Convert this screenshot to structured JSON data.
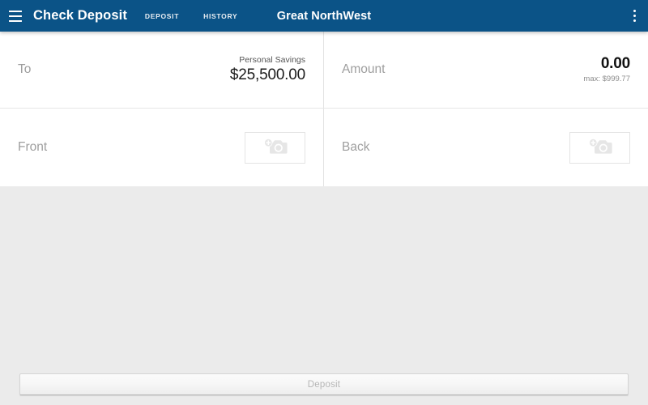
{
  "appbar": {
    "menu_icon": "hamburger-menu-icon",
    "title": "Check Deposit",
    "tabs": [
      {
        "label": "DEPOSIT"
      },
      {
        "label": "HISTORY"
      }
    ],
    "bank_name": "Great NorthWest",
    "overflow_icon": "more-vertical-icon",
    "background_color": "#0b5387"
  },
  "form": {
    "to": {
      "label": "To",
      "account_name": "Personal Savings",
      "account_balance": "$25,500.00"
    },
    "amount": {
      "label": "Amount",
      "value": "0.00",
      "max_note": "max: $999.77"
    },
    "front": {
      "label": "Front",
      "capture_icon": "add-photo-camera-icon"
    },
    "back": {
      "label": "Back",
      "capture_icon": "add-photo-camera-icon"
    }
  },
  "footer": {
    "deposit_label": "Deposit"
  },
  "colors": {
    "accent": "#0b5387",
    "page_background": "#ebebeb",
    "card_background": "#ffffff",
    "label_gray": "#9e9e9e",
    "disabled_text": "#b6b6b6"
  }
}
